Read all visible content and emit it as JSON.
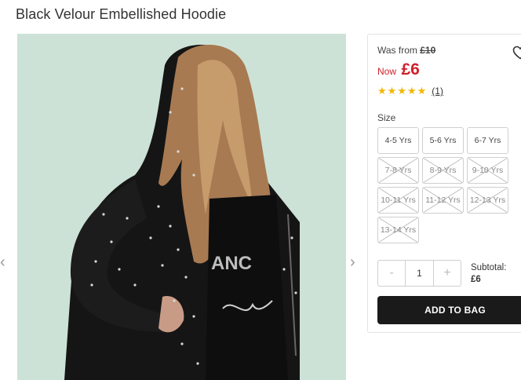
{
  "product": {
    "title": "Black Velour Embellished Hoodie",
    "image_alt": "Girl wearing black velour embellished hoodie"
  },
  "gallery": {
    "prev_icon": "chevron-left-icon",
    "next_icon": "chevron-right-icon",
    "prev_glyph": "‹",
    "next_glyph": "›"
  },
  "price": {
    "was_label": "Was from",
    "was_value": "£10",
    "now_label": "Now",
    "now_value": "£6",
    "accent_color": "#d0202a"
  },
  "rating": {
    "stars": 5,
    "max_stars": 5,
    "review_count": "(1)"
  },
  "sizes": {
    "label": "Size",
    "options": [
      {
        "label": "4-5 Yrs",
        "available": true
      },
      {
        "label": "5-6 Yrs",
        "available": true
      },
      {
        "label": "6-7 Yrs",
        "available": true
      },
      {
        "label": "7-8 Yrs",
        "available": false
      },
      {
        "label": "8-9 Yrs",
        "available": false
      },
      {
        "label": "9-10 Yrs",
        "available": false
      },
      {
        "label": "10-11 Yrs",
        "available": false
      },
      {
        "label": "11-12 Yrs",
        "available": false
      },
      {
        "label": "12-13 Yrs",
        "available": false
      },
      {
        "label": "13-14 Yrs",
        "available": false
      }
    ]
  },
  "quantity": {
    "minus": "-",
    "value": "1",
    "plus": "+"
  },
  "subtotal": {
    "label": "Subtotal:",
    "value": "£6"
  },
  "actions": {
    "add_to_bag": "ADD TO BAG",
    "wishlist_icon": "heart-icon"
  }
}
